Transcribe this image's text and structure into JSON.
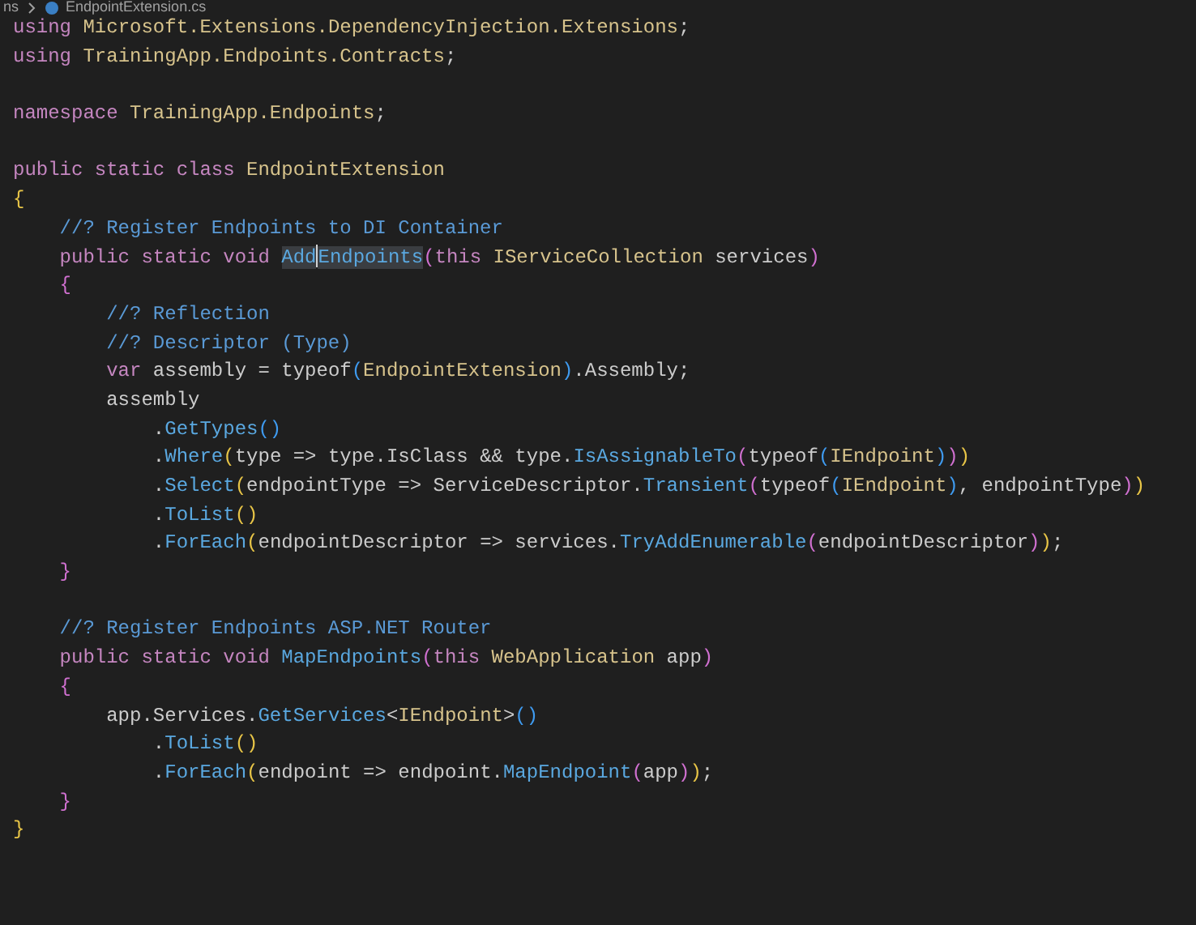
{
  "breadcrumb": {
    "folder": "ns",
    "file": "EndpointExtension.cs"
  },
  "lines": [
    {
      "tokens": [
        {
          "text": "using",
          "kind": "keyword"
        },
        {
          "text": " Microsoft.Extensions.DependencyInjection.Extensions",
          "kind": "type"
        },
        {
          "text": ";",
          "kind": "plain"
        }
      ]
    },
    {
      "tokens": [
        {
          "text": "using",
          "kind": "keyword"
        },
        {
          "text": " TrainingApp.Endpoints.Contracts",
          "kind": "type"
        },
        {
          "text": ";",
          "kind": "plain"
        }
      ]
    },
    {
      "blank_before": true,
      "tokens": [
        {
          "text": "namespace",
          "kind": "keyword"
        },
        {
          "text": " TrainingApp.Endpoints",
          "kind": "type"
        },
        {
          "text": ";",
          "kind": "plain"
        }
      ]
    },
    {
      "blank_before": true,
      "tokens": [
        {
          "text": "public static class",
          "kind": "keyword"
        },
        {
          "text": " EndpointExtension",
          "kind": "type"
        }
      ]
    },
    {
      "tokens": [
        {
          "text": "{",
          "kind": "gold"
        }
      ]
    },
    {
      "tokens": [
        {
          "text": "    //? Register Endpoints to DI Container",
          "kind": "comment"
        }
      ]
    },
    {
      "tokens": [
        {
          "text": "    public static void ",
          "kind": "keyword"
        },
        {
          "text": "Add",
          "kind": "method",
          "highlight": true,
          "cursor": true
        },
        {
          "text": "Endpoints",
          "kind": "method",
          "highlight": true,
          "cursor": false
        },
        {
          "text": "(",
          "kind": "magenta"
        },
        {
          "text": "this",
          "kind": "keyword"
        },
        {
          "text": " IServiceCollection",
          "kind": "type"
        },
        {
          "text": " services",
          "kind": "plain"
        },
        {
          "text": ")",
          "kind": "magenta"
        }
      ]
    },
    {
      "tokens": [
        {
          "text": "    {",
          "kind": "magenta"
        }
      ]
    },
    {
      "tokens": [
        {
          "text": "        //? Reflection",
          "kind": "comment"
        }
      ]
    },
    {
      "tokens": [
        {
          "text": "        //? Descriptor (Type)",
          "kind": "comment"
        }
      ]
    },
    {
      "tokens": [
        {
          "text": "        var",
          "kind": "keyword"
        },
        {
          "text": " assembly = typeof",
          "kind": "plain"
        },
        {
          "text": "(",
          "kind": "blue"
        },
        {
          "text": "EndpointExtension",
          "kind": "type"
        },
        {
          "text": ")",
          "kind": "blue"
        },
        {
          "text": ".Assembly;",
          "kind": "plain"
        }
      ]
    },
    {
      "tokens": [
        {
          "text": "        assembly",
          "kind": "plain"
        }
      ]
    },
    {
      "tokens": [
        {
          "text": "            .",
          "kind": "plain"
        },
        {
          "text": "GetTypes",
          "kind": "method"
        },
        {
          "text": "()",
          "kind": "blue"
        }
      ]
    },
    {
      "tokens": [
        {
          "text": "            .",
          "kind": "plain"
        },
        {
          "text": "Where",
          "kind": "method"
        },
        {
          "text": "(",
          "kind": "gold"
        },
        {
          "text": "type => type.IsClass && type.",
          "kind": "plain"
        },
        {
          "text": "IsAssignableTo",
          "kind": "method"
        },
        {
          "text": "(",
          "kind": "magenta"
        },
        {
          "text": "typeof",
          "kind": "plain"
        },
        {
          "text": "(",
          "kind": "blue"
        },
        {
          "text": "IEndpoint",
          "kind": "type"
        },
        {
          "text": ")",
          "kind": "blue"
        },
        {
          "text": ")",
          "kind": "magenta"
        },
        {
          "text": ")",
          "kind": "gold"
        }
      ]
    },
    {
      "tokens": [
        {
          "text": "            .",
          "kind": "plain"
        },
        {
          "text": "Select",
          "kind": "method"
        },
        {
          "text": "(",
          "kind": "gold"
        },
        {
          "text": "endpointType => ServiceDescriptor.",
          "kind": "plain"
        },
        {
          "text": "Transient",
          "kind": "method"
        },
        {
          "text": "(",
          "kind": "magenta"
        },
        {
          "text": "typeof",
          "kind": "plain"
        },
        {
          "text": "(",
          "kind": "blue"
        },
        {
          "text": "IEndpoint",
          "kind": "type"
        },
        {
          "text": ")",
          "kind": "blue"
        },
        {
          "text": ", endpointType",
          "kind": "plain"
        },
        {
          "text": ")",
          "kind": "magenta"
        },
        {
          "text": ")",
          "kind": "gold"
        }
      ]
    },
    {
      "tokens": [
        {
          "text": "            .",
          "kind": "plain"
        },
        {
          "text": "ToList",
          "kind": "method"
        },
        {
          "text": "()",
          "kind": "gold"
        }
      ]
    },
    {
      "tokens": [
        {
          "text": "            .",
          "kind": "plain"
        },
        {
          "text": "ForEach",
          "kind": "method"
        },
        {
          "text": "(",
          "kind": "gold"
        },
        {
          "text": "endpointDescriptor => services.",
          "kind": "plain"
        },
        {
          "text": "TryAddEnumerable",
          "kind": "method"
        },
        {
          "text": "(",
          "kind": "magenta"
        },
        {
          "text": "endpointDescriptor",
          "kind": "plain"
        },
        {
          "text": ")",
          "kind": "magenta"
        },
        {
          "text": ")",
          "kind": "gold"
        },
        {
          "text": ";",
          "kind": "plain"
        }
      ]
    },
    {
      "tokens": [
        {
          "text": "    }",
          "kind": "magenta"
        }
      ]
    },
    {
      "blank_before": true,
      "tokens": [
        {
          "text": "    //? Register Endpoints ASP.NET Router",
          "kind": "comment"
        }
      ]
    },
    {
      "tokens": [
        {
          "text": "    public static void",
          "kind": "keyword"
        },
        {
          "text": " MapEndpoints",
          "kind": "method"
        },
        {
          "text": "(",
          "kind": "magenta"
        },
        {
          "text": "this",
          "kind": "keyword"
        },
        {
          "text": " WebApplication",
          "kind": "type"
        },
        {
          "text": " app",
          "kind": "plain"
        },
        {
          "text": ")",
          "kind": "magenta"
        }
      ]
    },
    {
      "tokens": [
        {
          "text": "    {",
          "kind": "magenta"
        }
      ]
    },
    {
      "tokens": [
        {
          "text": "        app.Services.",
          "kind": "plain"
        },
        {
          "text": "GetServices",
          "kind": "method"
        },
        {
          "text": "<",
          "kind": "plain"
        },
        {
          "text": "IEndpoint",
          "kind": "type"
        },
        {
          "text": ">",
          "kind": "plain"
        },
        {
          "text": "()",
          "kind": "blue"
        }
      ]
    },
    {
      "tokens": [
        {
          "text": "            .",
          "kind": "plain"
        },
        {
          "text": "ToList",
          "kind": "method"
        },
        {
          "text": "()",
          "kind": "gold"
        }
      ]
    },
    {
      "tokens": [
        {
          "text": "            .",
          "kind": "plain"
        },
        {
          "text": "ForEach",
          "kind": "method"
        },
        {
          "text": "(",
          "kind": "gold"
        },
        {
          "text": "endpoint => endpoint.",
          "kind": "plain"
        },
        {
          "text": "MapEndpoint",
          "kind": "method"
        },
        {
          "text": "(",
          "kind": "magenta"
        },
        {
          "text": "app",
          "kind": "plain"
        },
        {
          "text": ")",
          "kind": "magenta"
        },
        {
          "text": ")",
          "kind": "gold"
        },
        {
          "text": ";",
          "kind": "plain"
        }
      ]
    },
    {
      "tokens": [
        {
          "text": "    }",
          "kind": "magenta"
        }
      ]
    },
    {
      "tokens": [
        {
          "text": "}",
          "kind": "gold"
        }
      ]
    }
  ]
}
